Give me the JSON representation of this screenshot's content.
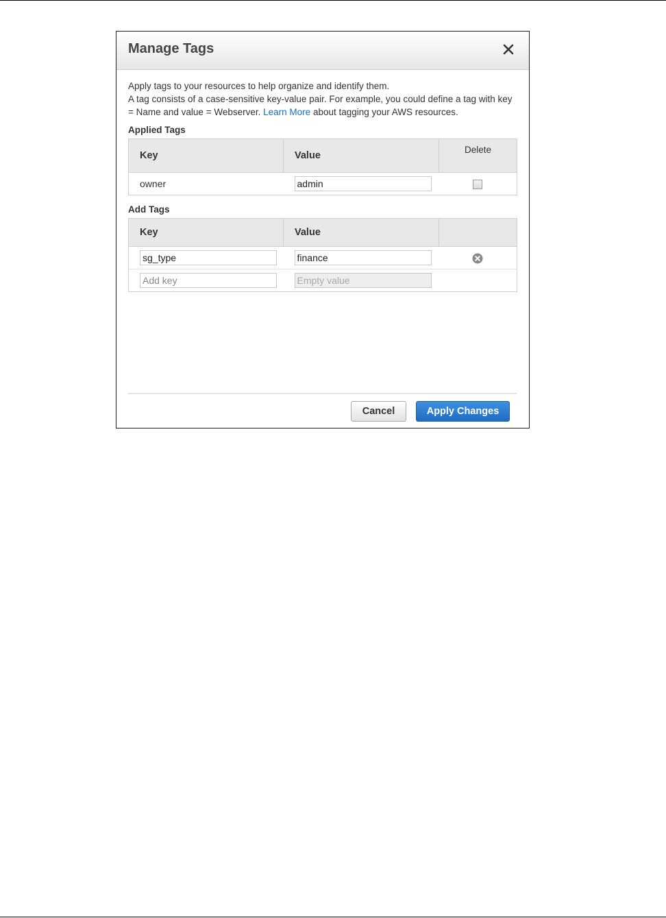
{
  "dialog": {
    "title": "Manage Tags",
    "intro_line1": "Apply tags to your resources to help organize and identify them.",
    "intro_line2_start": "A tag consists of a case-sensitive key-value pair. For example, you could define a tag with key = Name and value = Webserver.",
    "learn_more": "Learn More",
    "intro_line2_end": "about tagging your AWS resources.",
    "close_icon": "close-icon"
  },
  "applied_tags": {
    "title": "Applied Tags",
    "columns": {
      "key": "Key",
      "value": "Value",
      "delete": "Delete"
    },
    "rows": [
      {
        "key": "owner",
        "value": "admin",
        "delete_checked": false
      }
    ]
  },
  "add_tags": {
    "title": "Add Tags",
    "columns": {
      "key": "Key",
      "value": "Value"
    },
    "rows": [
      {
        "key": "sg_type",
        "value": "finance"
      }
    ],
    "new_row": {
      "key_placeholder": "Add key",
      "value_placeholder": "Empty value"
    }
  },
  "footer": {
    "cancel_label": "Cancel",
    "apply_label": "Apply Changes"
  },
  "colors": {
    "primary": "#1f6cc4",
    "link": "#1a6fc4",
    "header_bg": "#e8e8e8"
  }
}
